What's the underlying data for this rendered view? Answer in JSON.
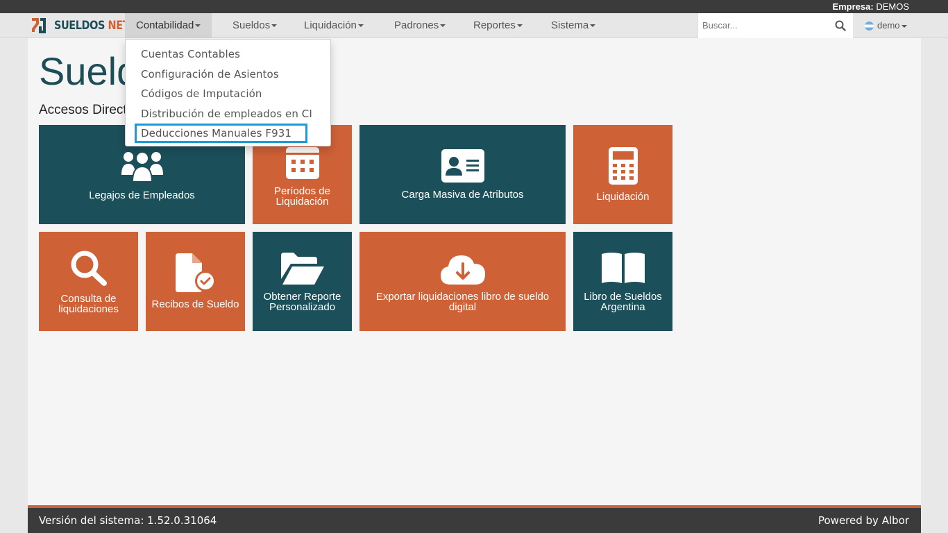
{
  "top": {
    "empresa_label": "Empresa:",
    "empresa_value": "DEMOS"
  },
  "brand": {
    "part1": "SUELDOS",
    "part2": "NET"
  },
  "nav": [
    {
      "label": "Contabilidad"
    },
    {
      "label": "Sueldos"
    },
    {
      "label": "Liquidación"
    },
    {
      "label": "Padrones"
    },
    {
      "label": "Reportes"
    },
    {
      "label": "Sistema"
    }
  ],
  "search": {
    "placeholder": "Buscar..."
  },
  "user": {
    "name": "demo"
  },
  "page": {
    "title": "Sueldos",
    "section": "Accesos Directos"
  },
  "dropdown": {
    "items": [
      "Cuentas Contables",
      "Configuración de Asientos",
      "Códigos de Imputación",
      "Distribución de empleados en CI",
      "Deducciones Manuales F931"
    ]
  },
  "tiles": [
    {
      "label": "Legajos de Empleados",
      "icon": "users-icon"
    },
    {
      "label": "Períodos de Liquidación",
      "icon": "calendar-icon"
    },
    {
      "label": "Carga Masiva de Atributos",
      "icon": "id-card-icon"
    },
    {
      "label": "Liquidación",
      "icon": "calculator-icon"
    },
    {
      "label": "Consulta de liquidaciones",
      "icon": "search-icon"
    },
    {
      "label": "Recibos de Sueldo",
      "icon": "file-check-icon"
    },
    {
      "label": "Obtener Reporte Personalizado",
      "icon": "folder-open-icon"
    },
    {
      "label": "Exportar liquidaciones libro de sueldo digital",
      "icon": "cloud-download-icon"
    },
    {
      "label": "Libro de Sueldos Argentina",
      "icon": "book-icon"
    }
  ],
  "colors": {
    "teal": "#1b4f5a",
    "orange": "#cf6137",
    "highlight": "#1a9ad9"
  },
  "footer": {
    "version": "Versión del sistema: 1.52.0.31064",
    "powered": "Powered by Albor"
  }
}
